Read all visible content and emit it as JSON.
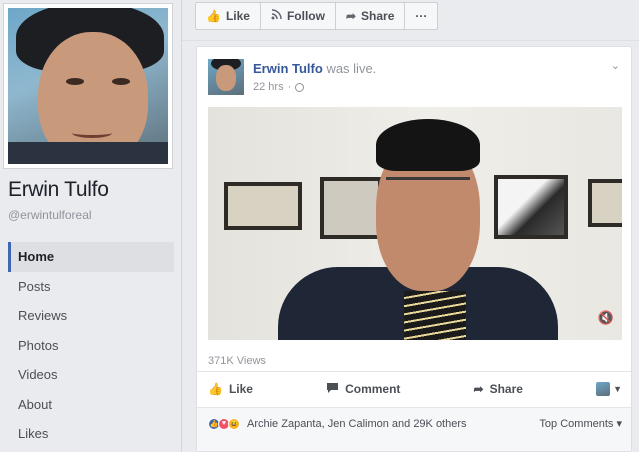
{
  "page": {
    "name": "Erwin Tulfo",
    "handle": "@erwintulforeal"
  },
  "nav": {
    "items": [
      {
        "label": "Home",
        "active": true
      },
      {
        "label": "Posts",
        "active": false
      },
      {
        "label": "Reviews",
        "active": false
      },
      {
        "label": "Photos",
        "active": false
      },
      {
        "label": "Videos",
        "active": false
      },
      {
        "label": "About",
        "active": false
      },
      {
        "label": "Likes",
        "active": false
      }
    ]
  },
  "action_bar": {
    "like_label": "Like",
    "follow_label": "Follow",
    "share_label": "Share",
    "more_label": "···"
  },
  "post": {
    "author": "Erwin Tulfo",
    "verb": "was live.",
    "time": "22 hrs",
    "time_sep": "·",
    "views": "371K Views",
    "like_label": "Like",
    "comment_label": "Comment",
    "share_label": "Share",
    "reaction_summary": "Archie Zapanta, Jen Calimon and 29K others",
    "sort_label": "Top Comments",
    "sort_caret": "▾"
  },
  "icons": {
    "like": "like-icon",
    "follow": "rss-icon",
    "share": "share-arrow-icon",
    "comment": "comment-icon",
    "globe": "globe-icon",
    "mute": "mute-icon"
  },
  "colors": {
    "link": "#365899",
    "accent": "#4267b2",
    "muted": "#90949c"
  }
}
